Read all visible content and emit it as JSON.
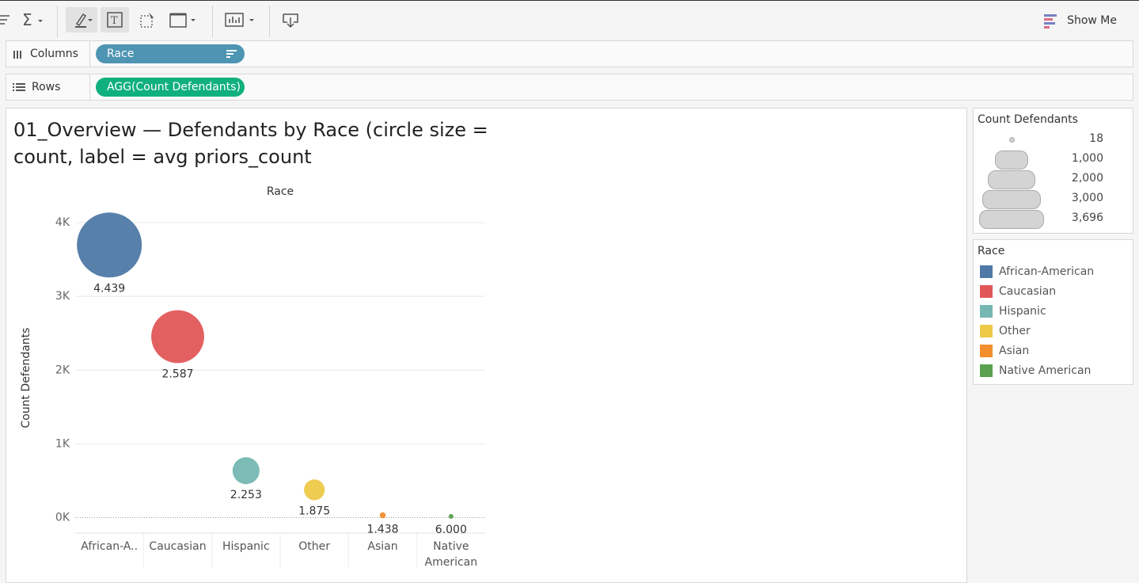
{
  "toolbar": {
    "icons": [
      "sort-icon",
      "sum-icon",
      "highlight-icon",
      "text-label-icon",
      "select-icon",
      "fit-icon",
      "presentation-icon",
      "download-icon"
    ],
    "show_me_label": "Show Me"
  },
  "shelves": {
    "columns_label": "Columns",
    "columns_pill": "Race",
    "rows_label": "Rows",
    "rows_pill": "AGG(Count Defendants)"
  },
  "sheet": {
    "title": "01_Overview — Defendants by Race (circle size = count, label = avg priors_count"
  },
  "chart_data": {
    "type": "scatter",
    "title": "01_Overview — Defendants by Race (circle size = count, label = avg priors_count",
    "header": "Race",
    "ylabel": "Count Defendants",
    "categories": [
      "African-American",
      "Caucasian",
      "Hispanic",
      "Other",
      "Asian",
      "Native American"
    ],
    "category_labels": [
      "African-A..",
      "Caucasian",
      "Hispanic",
      "Other",
      "Asian",
      "Native American"
    ],
    "values": [
      3696,
      2454,
      637,
      377,
      32,
      18
    ],
    "labels": [
      "4.439",
      "2.587",
      "2.253",
      "1.875",
      "1.438",
      "6.000"
    ],
    "colors": [
      "#4e79a7",
      "#e15759",
      "#76b7b2",
      "#edc948",
      "#f28e2b",
      "#59a14f"
    ],
    "yticks": [
      0,
      1000,
      2000,
      3000,
      4000
    ],
    "ytick_labels": [
      "0K",
      "1K",
      "2K",
      "3K",
      "4K"
    ],
    "ylim": [
      -100,
      4300
    ],
    "grid": true
  },
  "size_legend": {
    "title": "Count Defendants",
    "values": [
      18,
      1000,
      2000,
      3000,
      3696
    ],
    "labels": [
      "18",
      "1,000",
      "2,000",
      "3,000",
      "3,696"
    ]
  },
  "color_legend": {
    "title": "Race",
    "items": [
      {
        "label": "African-American",
        "color": "#4e79a7"
      },
      {
        "label": "Caucasian",
        "color": "#e15759"
      },
      {
        "label": "Hispanic",
        "color": "#76b7b2"
      },
      {
        "label": "Other",
        "color": "#edc948"
      },
      {
        "label": "Asian",
        "color": "#f28e2b"
      },
      {
        "label": "Native American",
        "color": "#59a14f"
      }
    ]
  }
}
